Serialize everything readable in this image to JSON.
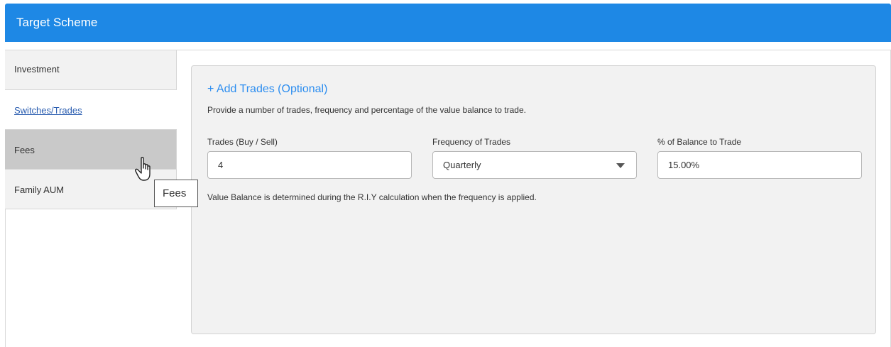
{
  "header": {
    "title": "Target Scheme"
  },
  "sidebar": {
    "items": [
      {
        "label": "Investment"
      },
      {
        "label": "Switches/Trades"
      },
      {
        "label": "Fees"
      },
      {
        "label": "Family AUM"
      }
    ]
  },
  "trades": {
    "add_link": "+ Add Trades (Optional)",
    "description": "Provide a number of trades, frequency and percentage of the value balance to trade.",
    "fields": {
      "count_label": "Trades (Buy / Sell)",
      "count_value": "4",
      "frequency_label": "Frequency of Trades",
      "frequency_value": "Quarterly",
      "balance_label": "% of Balance to Trade",
      "balance_value": "15.00%"
    },
    "note": "Value Balance is determined during the R.I.Y calculation when the frequency is applied."
  },
  "tooltip": {
    "text": "Fees"
  },
  "icons": {
    "cursor": "hand-pointer-icon",
    "dropdown": "caret-down-icon"
  },
  "colors": {
    "header": "#1e88e5",
    "link": "#2d8ef0",
    "active_link": "#2a5db0"
  }
}
